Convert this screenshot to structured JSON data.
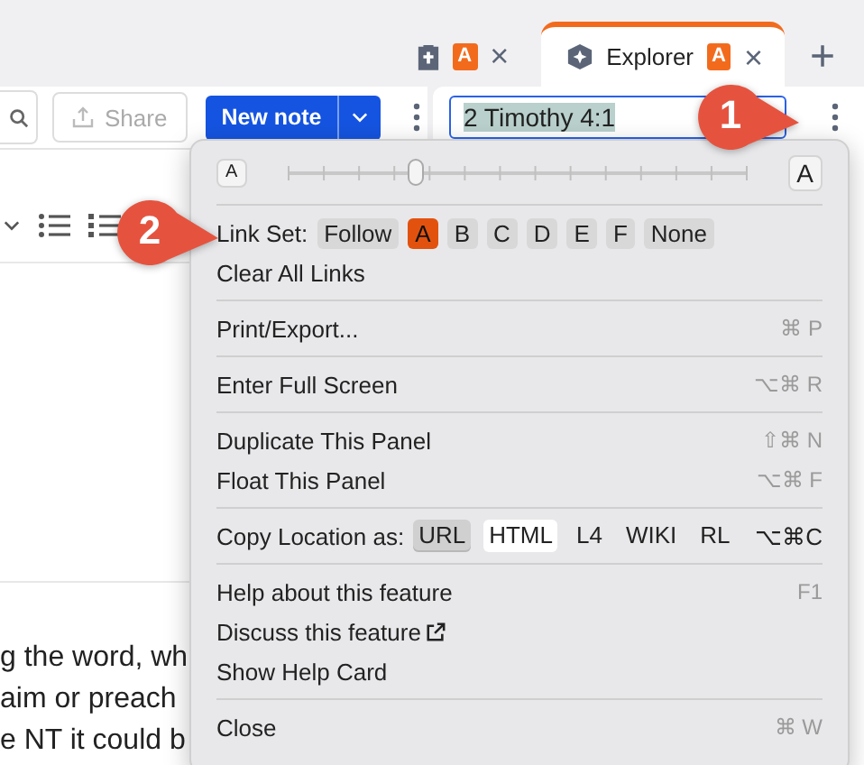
{
  "tabs": [
    {
      "kind": "notes",
      "badge": "A",
      "close": "×",
      "selected": false
    },
    {
      "kind": "explorer",
      "label": "Explorer",
      "badge": "A",
      "close": "×",
      "selected": true
    }
  ],
  "add_tab": "+",
  "left_toolbar": {
    "share": "Share",
    "new_note": "New note"
  },
  "reference_field": {
    "value": "2 Timothy 4:1"
  },
  "body_text": [
    "g the word, wh",
    "aim or preach",
    "e NT it could b"
  ],
  "menu": {
    "groups": [
      [
        {
          "kind": "slider",
          "small": "A",
          "large": "A",
          "level": 0.28
        }
      ],
      [
        {
          "kind": "link-set",
          "label": "Link Set:",
          "options": [
            {
              "label": "Follow",
              "selected": false
            },
            {
              "label": "A",
              "selected": true
            },
            {
              "label": "B",
              "selected": false
            },
            {
              "label": "C",
              "selected": false
            },
            {
              "label": "D",
              "selected": false
            },
            {
              "label": "E",
              "selected": false
            },
            {
              "label": "F",
              "selected": false
            },
            {
              "label": "None",
              "selected": false
            }
          ]
        },
        {
          "kind": "command",
          "label": "Clear All Links"
        }
      ],
      [
        {
          "kind": "command",
          "label": "Print/Export...",
          "shortcut": "⌘ P"
        }
      ],
      [
        {
          "kind": "command",
          "label": "Enter Full Screen",
          "shortcut": "⌥⌘ R"
        }
      ],
      [
        {
          "kind": "command",
          "label": "Duplicate This Panel",
          "shortcut": "⇧⌘ N"
        },
        {
          "kind": "command",
          "label": "Float This Panel",
          "shortcut": "⌥⌘ F"
        }
      ],
      [
        {
          "kind": "copy-location",
          "label": "Copy Location as:",
          "options": [
            {
              "label": "URL",
              "selected": true,
              "hovered": false
            },
            {
              "label": "HTML",
              "selected": false,
              "hovered": true
            },
            {
              "label": "L4",
              "selected": false,
              "hovered": false
            },
            {
              "label": "WIKI",
              "selected": false,
              "hovered": false
            },
            {
              "label": "RL",
              "selected": false,
              "hovered": false
            }
          ],
          "shortcut": "⌥⌘C"
        }
      ],
      [
        {
          "kind": "command",
          "label": "Help about this feature",
          "shortcut": "F1"
        },
        {
          "kind": "command",
          "label": "Discuss this feature",
          "external": true
        },
        {
          "kind": "command",
          "label": "Show Help Card"
        }
      ],
      [
        {
          "kind": "command",
          "label": "Close",
          "shortcut": "⌘ W"
        }
      ]
    ]
  },
  "callouts": [
    {
      "number": "1"
    },
    {
      "number": "2"
    }
  ]
}
